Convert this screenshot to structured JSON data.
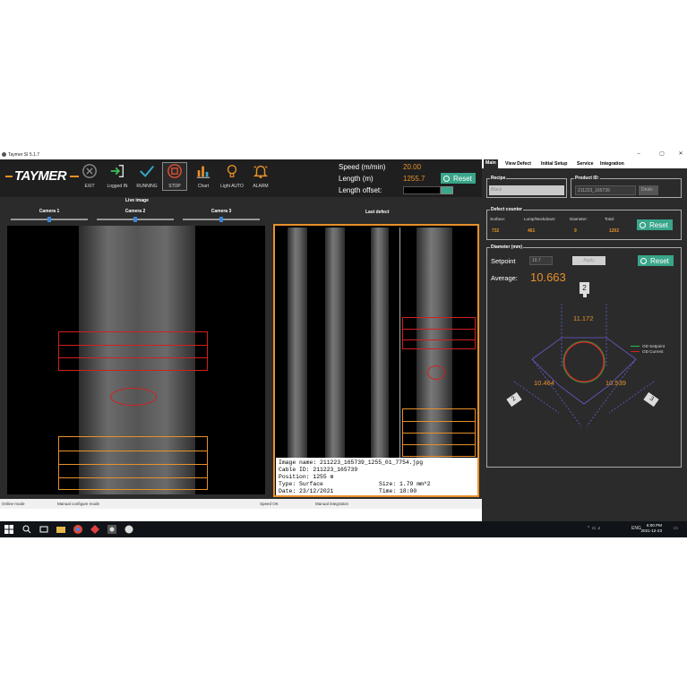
{
  "window": {
    "title": "Taymer SI 5.1.7"
  },
  "toolbar": {
    "logo_text": "TAYMER",
    "buttons": [
      {
        "label": "EXIT",
        "icon": "close-circle-icon"
      },
      {
        "label": "Logged IN",
        "icon": "login-arrow-icon"
      },
      {
        "label": "RUNNING",
        "icon": "checkmark-icon"
      },
      {
        "label": "STOP",
        "icon": "stop-icon"
      },
      {
        "label": "Chart",
        "icon": "bar-chart-icon"
      },
      {
        "label": "Light AUTO",
        "icon": "light-bulb-icon"
      },
      {
        "label": "ALARM",
        "icon": "alarm-bell-icon"
      }
    ]
  },
  "measurements": {
    "speed_label": "Speed (m/min)",
    "speed_value": "20.00",
    "length_label": "Length (m)",
    "length_value": "1255.7",
    "offset_label": "Length offset:",
    "reset_label": "Reset"
  },
  "live": {
    "title": "Live image",
    "cameras": [
      "Camera 1",
      "Camera 2",
      "Camera 3"
    ],
    "slider_positions": [
      0.5,
      0.5,
      0.5
    ]
  },
  "last_defect": {
    "title": "Last defect",
    "image_name_label": "Image name:",
    "image_name": "211223_165739_1255_01_7754.jpg",
    "cable_id_label": "Cable ID:",
    "cable_id": "211223_165739",
    "position_label": "Position:",
    "position": "1255 m",
    "type_label": "Type:",
    "type": "Surface",
    "size_label": "Size:",
    "size": "1.79 mm^2",
    "date_label": "Date:",
    "date": "23/12/2021",
    "time_label": "Time:",
    "time": "18:00"
  },
  "status_bar": {
    "items": [
      "Online mode",
      "Manual configure mode",
      "Speed OK",
      "Manual integration"
    ]
  },
  "right_panel": {
    "tabs": [
      "Main",
      "View Defect",
      "Initial Setup",
      "Service",
      "Integration"
    ],
    "active_tab": "Main",
    "recipe": {
      "title": "Recipe",
      "value": "Black"
    },
    "product": {
      "title": "Product ID:",
      "value": "211223_165739",
      "button": "Deals"
    },
    "defect_counter": {
      "title": "Defect counter",
      "labels": [
        "Surface:",
        "Lump/Neckdown:",
        "Diameter:",
        "Total:"
      ],
      "values": [
        "732",
        "461",
        "9",
        "1202"
      ],
      "reset_label": "Reset"
    },
    "diameter": {
      "title": "Diameter (mm)",
      "setpoint_label": "Setpoint",
      "setpoint_value": "10.7",
      "apply_label": "Apply",
      "reset_label": "Reset",
      "average_label": "Average:",
      "average_value": "10.663",
      "camera_top": "2",
      "camera_left": "2",
      "camera_right": "3",
      "value_top": "11.172",
      "value_left": "10.464",
      "value_right": "10.539",
      "legend": [
        {
          "label": "OD Setpoint",
          "color": "#2fbf4a"
        },
        {
          "label": "OD Current",
          "color": "#d12020"
        }
      ]
    }
  },
  "taskbar": {
    "time": "6:00 PM",
    "date": "2021-12-23",
    "lang": "ENG"
  },
  "colors": {
    "accent": "#e8902a",
    "button": "#3aa58a",
    "defect": "#d12020"
  }
}
